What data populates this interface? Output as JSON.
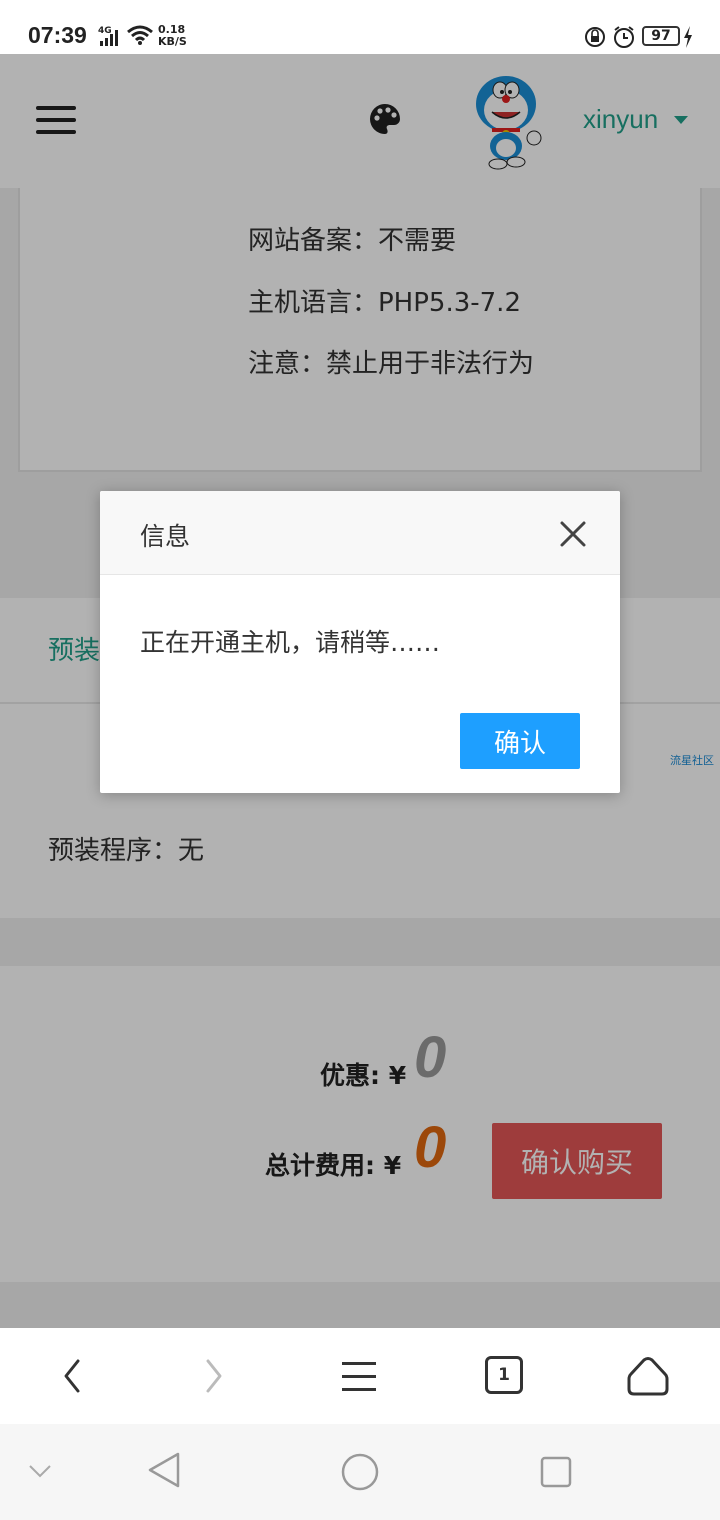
{
  "status_bar": {
    "time": "07:39",
    "network": "4G",
    "speed_value": "0.18",
    "speed_unit": "KB/S",
    "battery": "97"
  },
  "header": {
    "username": "xinyun"
  },
  "specs": [
    "网站备案：不需要",
    "主机语言：PHP5.3-7.2",
    "注意：禁止用于非法行为"
  ],
  "install_section": {
    "label": "预装",
    "watermark": "流星社区",
    "preinstall": "预装程序：无"
  },
  "pricing": {
    "discount_label": "优惠: ¥",
    "discount_value": "0",
    "total_label": "总计费用: ¥",
    "total_value": "0",
    "buy_button": "确认购买"
  },
  "dialog": {
    "title": "信息",
    "message": "正在开通主机，请稍等……",
    "ok_button": "确认"
  },
  "browser_toolbar": {
    "tab_count": "1"
  },
  "colors": {
    "accent_green": "#21a08a",
    "dialog_button": "#1e9fff",
    "buy_button": "#e25757",
    "total_value": "#e0680f",
    "discount_value": "#9a9a9a"
  }
}
